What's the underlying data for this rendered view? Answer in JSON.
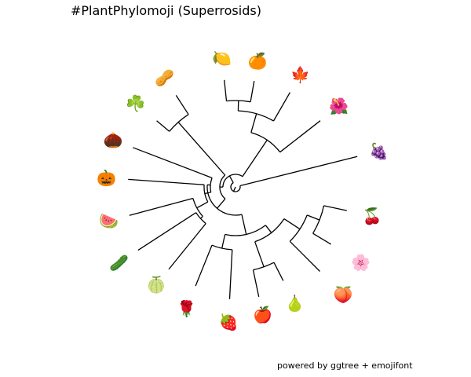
{
  "title": "#PlantPhylomoji (Superrosids)",
  "caption": "powered by ggtree + emojifont",
  "branch_color": "#000000",
  "tips": [
    {
      "name": "grapes",
      "glyph": "🍇"
    },
    {
      "name": "cherries",
      "glyph": "🍒"
    },
    {
      "name": "cherry-blossom",
      "glyph": "🌸"
    },
    {
      "name": "peach",
      "glyph": "🍑"
    },
    {
      "name": "pear",
      "glyph": "🍐"
    },
    {
      "name": "red-apple",
      "glyph": "🍎"
    },
    {
      "name": "strawberry",
      "glyph": "🍓"
    },
    {
      "name": "rose",
      "glyph": "🌹"
    },
    {
      "name": "melon",
      "glyph": "🍈"
    },
    {
      "name": "cucumber",
      "glyph": "🥒"
    },
    {
      "name": "watermelon",
      "glyph": "🍉"
    },
    {
      "name": "jack-o-lantern",
      "glyph": "🎃"
    },
    {
      "name": "chestnut",
      "glyph": "🌰"
    },
    {
      "name": "shamrock",
      "glyph": "☘️"
    },
    {
      "name": "peanuts",
      "glyph": "🥜"
    },
    {
      "name": "lemon",
      "glyph": "🍋"
    },
    {
      "name": "tangerine",
      "glyph": "🍊"
    },
    {
      "name": "maple-leaf",
      "glyph": "🍁"
    },
    {
      "name": "hibiscus",
      "glyph": "🌺"
    }
  ]
}
